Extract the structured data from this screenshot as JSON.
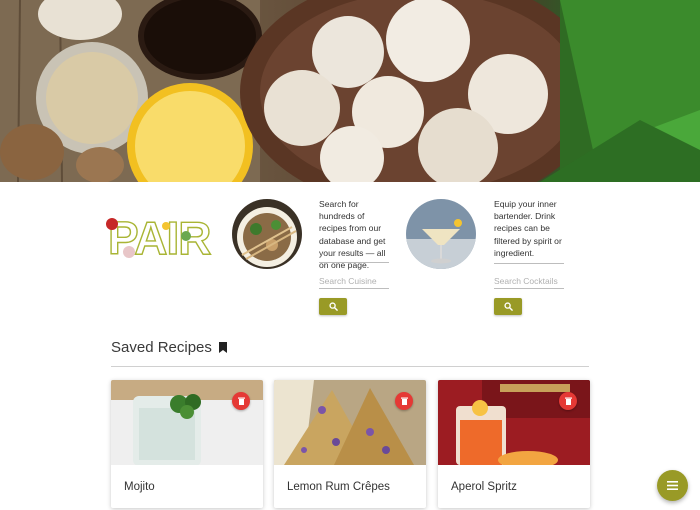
{
  "hero": {
    "image": "ingredients-banner"
  },
  "logo": {
    "text": "PAIR"
  },
  "intro": {
    "food": {
      "description": "Search for hundreds of recipes from our database and get your results — all on one page.",
      "placeholder": "Search Cuisine",
      "button_icon": "search-icon"
    },
    "drinks": {
      "description": "Equip your inner bartender. Drink recipes can be filtered by spirit or ingredient.",
      "placeholder": "Search Cocktails",
      "button_icon": "search-icon"
    }
  },
  "saved": {
    "title": "Saved Recipes",
    "icon": "bookmark-icon",
    "cards": [
      {
        "name": "Mojito",
        "delete_icon": "trash-icon"
      },
      {
        "name": "Lemon Rum Crêpes",
        "delete_icon": "trash-icon"
      },
      {
        "name": "Aperol Spritz",
        "delete_icon": "trash-icon"
      }
    ]
  },
  "fab": {
    "icon": "menu-icon"
  },
  "colors": {
    "accent": "#999a26",
    "delete": "#e53935",
    "text": "#333333"
  }
}
